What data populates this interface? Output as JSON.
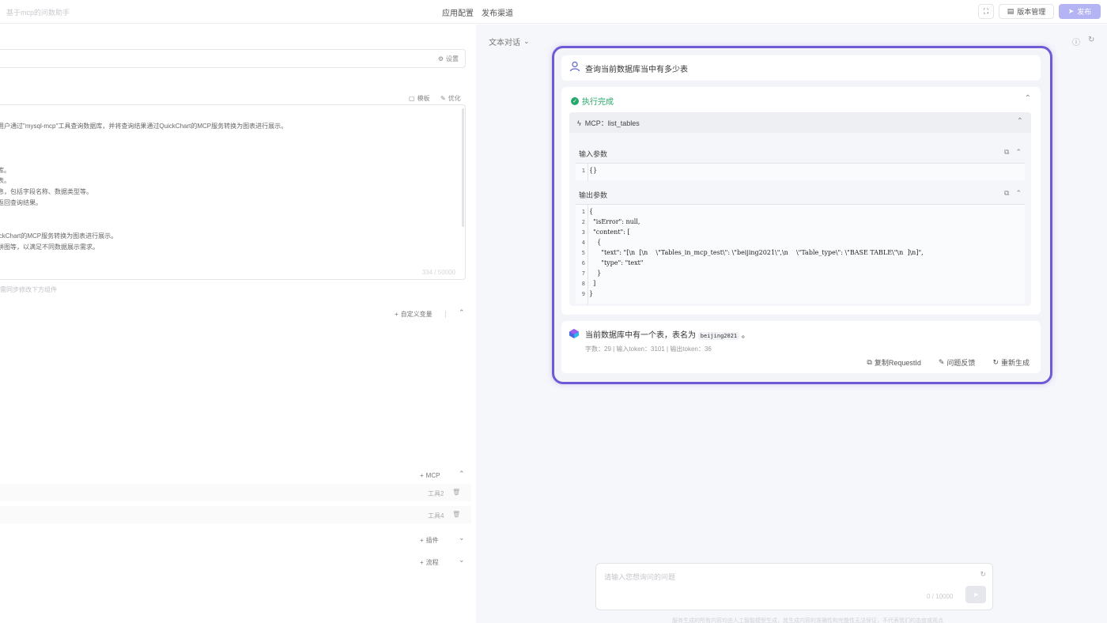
{
  "topbar": {
    "app_name": "基于mcp的问数助手",
    "tabs": [
      "应用配置",
      "发布渠道"
    ],
    "version_label": "版本管理",
    "publish_label": "发布"
  },
  "left": {
    "settings_label": "设置",
    "template_label": "模板",
    "optimize_label": "优化",
    "prompt_lines": [
      "用户通过\"mysql-mcp\"工具查询数据库，并将查询结果通过QuickChart的MCP服务转换为图表进行展示。",
      "库。",
      "表。",
      "息，包括字段名称、数据类型等。",
      "返回查询结果。",
      "ickChart的MCP服务转换为图表进行展示。",
      "饼图等，以满足不同数据展示需求。"
    ],
    "prompt_count": "334 / 50000",
    "hint": "需同步修改下方组件",
    "custom_var_label": "自定义变量",
    "mcp_label": "MCP",
    "tools": [
      "工具2",
      "工具4"
    ],
    "plugin_label": "插件",
    "flow_label": "流程"
  },
  "right": {
    "mode_label": "文本对话",
    "user_question": "查询当前数据库当中有多少表",
    "exec_status": "执行完成",
    "mcp_title": "MCP：list_tables",
    "input_params_label": "输入参数",
    "output_params_label": "输出参数",
    "input_code": [
      {
        "n": "1",
        "text": "{}"
      }
    ],
    "output_code": [
      {
        "n": "1",
        "text": "{"
      },
      {
        "n": "2",
        "text": "  \"isError\": null,"
      },
      {
        "n": "3",
        "text": "  \"content\": ["
      },
      {
        "n": "4",
        "text": "    {"
      },
      {
        "n": "5",
        "text": "      \"text\": \"[\\n  [\\n    \\\"Tables_in_mcp_test\\\": \\\"beijing2021\\\",\\n    \\\"Table_type\\\": \\\"BASE TABLE\\\"\\n  ]\\n]\","
      },
      {
        "n": "6",
        "text": "      \"type\": \"text\""
      },
      {
        "n": "7",
        "text": "    }"
      },
      {
        "n": "8",
        "text": "  ]"
      },
      {
        "n": "9",
        "text": "}"
      }
    ],
    "answer_prefix": "当前数据库中有一个表，表名为",
    "answer_table": "beijing2021",
    "answer_suffix": "。",
    "answer_meta": "字数：29  | 输入token：3101 | 输出token：36",
    "copy_request_label": "复制RequestId",
    "feedback_label": "问题反馈",
    "regenerate_label": "重新生成",
    "chat_placeholder": "请输入您想询问的问题",
    "chat_counter": "0 / 10000",
    "footer_note": "服务生成的所有内容均由人工智能模型生成，其生成内容的准确性和完整性无法保证，不代表我们的态度或观点"
  },
  "colors": {
    "accent": "#6f59d6",
    "success": "#27a86b",
    "publish": "#b4b3f3"
  }
}
